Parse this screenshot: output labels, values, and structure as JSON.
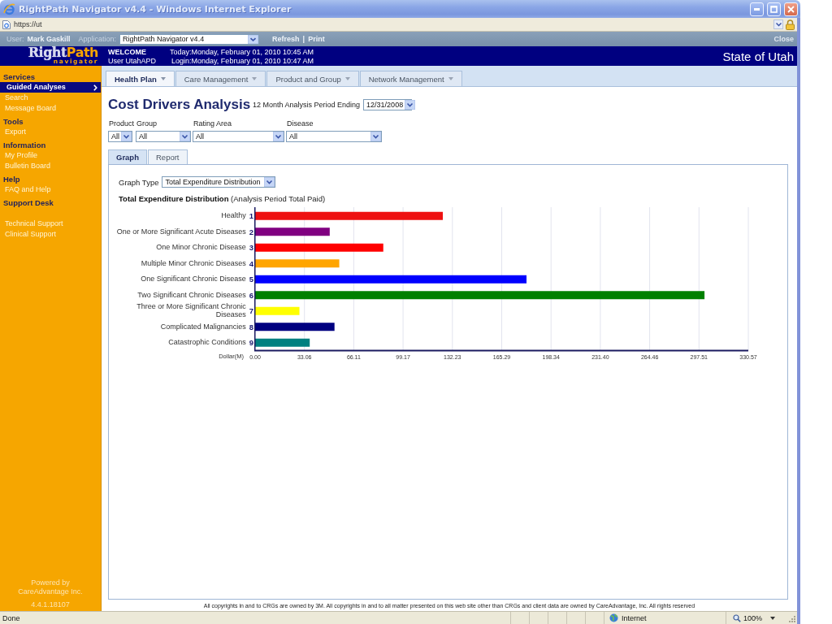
{
  "window": {
    "title": "RightPath Navigator v4.4 - Windows Internet Explorer",
    "address": "https://ut"
  },
  "app_bar": {
    "user_label": "User:",
    "user": "Mark Gaskill",
    "application_label": "Application:",
    "application": "RightPath Navigator v4.4",
    "links": [
      "Refresh",
      "Print"
    ],
    "link_separator": "|",
    "close": "Close"
  },
  "header": {
    "logo": {
      "first": "Right",
      "second": "Path",
      "tagline": "navigator"
    },
    "welcome": "WELCOME",
    "user_line": "User UtahAPD",
    "today": "Today:Monday, February 01, 2010 10:45 AM",
    "login": "Login:Monday, February 01, 2010 10:47 AM",
    "organization": "State of Utah"
  },
  "sidebar": {
    "sections": [
      {
        "title": "Services",
        "items": [
          {
            "label": "Guided Analyses",
            "selected": true
          },
          {
            "label": "Search",
            "selected": false
          },
          {
            "label": "Message Board",
            "selected": false
          }
        ]
      },
      {
        "title": "Tools",
        "items": [
          {
            "label": "Export",
            "selected": false
          }
        ]
      },
      {
        "title": "Information",
        "items": [
          {
            "label": "My Profile",
            "selected": false
          },
          {
            "label": "Bulletin Board",
            "selected": false
          }
        ]
      },
      {
        "title": "Help",
        "items": [
          {
            "label": "FAQ and Help",
            "selected": false
          }
        ]
      },
      {
        "title": "Support Desk",
        "items": [
          {
            "label": "Technical Support",
            "selected": false
          },
          {
            "label": "Clinical Support",
            "selected": false
          }
        ]
      }
    ],
    "powered_by": "Powered by CareAdvantage Inc.",
    "version": "4.4.1.18107"
  },
  "tabs": [
    {
      "label": "Health Plan",
      "selected": true
    },
    {
      "label": "Care Management",
      "selected": false
    },
    {
      "label": "Product and Group",
      "selected": false
    },
    {
      "label": "Network Management",
      "selected": false
    }
  ],
  "page": {
    "title": "Cost Drivers Analysis",
    "period_label": "12 Month Analysis Period Ending",
    "period": "12/31/2008"
  },
  "filters": [
    {
      "label": "Product",
      "value": "All"
    },
    {
      "label": "Group",
      "value": "All"
    },
    {
      "label": "Rating Area",
      "value": "All"
    },
    {
      "label": "Disease",
      "value": "All"
    }
  ],
  "view_tabs": [
    {
      "label": "Graph",
      "selected": true
    },
    {
      "label": "Report",
      "selected": false
    }
  ],
  "graph": {
    "type_label": "Graph Type",
    "type": "Total Expenditure Distribution",
    "chart_data": {
      "type": "bar",
      "orientation": "horizontal",
      "grid": true,
      "title": "**Total Expenditure Distribution** (Analysis Period Total Paid)",
      "xlabel": "Dollar(M)",
      "categories": [
        "Healthy **1**",
        "One or More Significant Acute Diseases **2**",
        "One Minor Chronic Disease **3**",
        "Multiple Minor Chronic Diseases **4**",
        "One Significant Chronic Disease **5**",
        "Two Significant Chronic Diseases **6**",
        "Three or More Significant Chronic Diseases **7**",
        "Complicated Malignancies **8**",
        "Catastrophic Conditions **9**"
      ],
      "values": [
        125.8,
        50.0,
        85.9,
        56.4,
        181.9,
        301.2,
        29.7,
        53.2,
        36.6
      ],
      "colors": [
        "#ee1111",
        "#800080",
        "#ff0000",
        "#ffa500",
        "#0000ff",
        "#008000",
        "#ffff00",
        "#000080",
        "#008080"
      ],
      "xlim": [
        0,
        330.57
      ],
      "xticks": [
        {
          "value": 0,
          "label": "0.00"
        },
        {
          "value": 33.06,
          "label": "33.06"
        },
        {
          "value": 66.11,
          "label": "66.11"
        },
        {
          "value": 99.17,
          "label": "99.17"
        },
        {
          "value": 132.23,
          "label": "132.23"
        },
        {
          "value": 165.29,
          "label": "165.29"
        },
        {
          "value": 198.34,
          "label": "198.34"
        },
        {
          "value": 231.4,
          "label": "231.40"
        },
        {
          "value": 264.46,
          "label": "264.46"
        },
        {
          "value": 297.51,
          "label": "297.51"
        },
        {
          "value": 330.57,
          "label": "330.57"
        }
      ]
    }
  },
  "footer": {
    "copyright": "All copyrights in and to CRGs are owned by 3M. All copyrights in and to all matter presented on this web site other than CRGs and client data are owned by CareAdvantage, Inc. All rights reserved"
  },
  "status_bar": {
    "status": "Done",
    "zone": "Internet",
    "zoom": "100%"
  }
}
